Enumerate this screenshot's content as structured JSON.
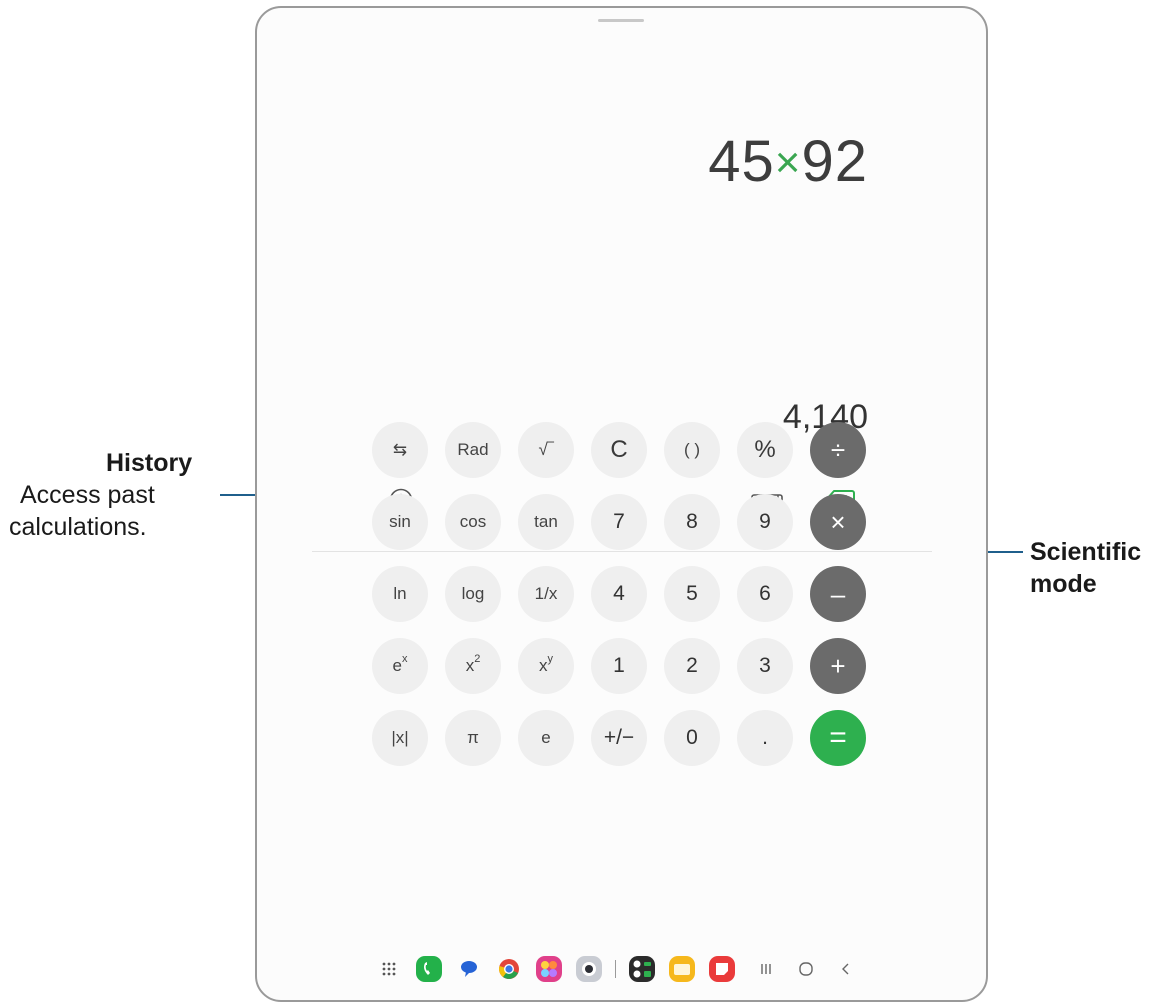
{
  "display": {
    "operand1": "45",
    "operator": "×",
    "operand2": "92",
    "result": "4,140"
  },
  "toolbar": {
    "history_icon": "clock-icon",
    "scientific_icon": "ruler-icon",
    "backspace_icon": "backspace-icon"
  },
  "keypad": {
    "rows": [
      [
        "⇆",
        "Rad",
        "√‾",
        "C",
        "( )",
        "%",
        "÷"
      ],
      [
        "sin",
        "cos",
        "tan",
        "7",
        "8",
        "9",
        "×"
      ],
      [
        "ln",
        "log",
        "1/x",
        "4",
        "5",
        "6",
        "–"
      ],
      [
        "e",
        "x",
        "x",
        "1",
        "2",
        "3",
        "+"
      ],
      [
        "|x|",
        "π",
        "e",
        "+/−",
        "0",
        ".",
        "="
      ]
    ],
    "superscripts": {
      "e_pow": "x",
      "x_sq": "2",
      "x_pow": "y"
    }
  },
  "annotations": {
    "history_title": "History",
    "history_line1": "Access past",
    "history_line2": "calculations.",
    "scientific_line1": "Scientific",
    "scientific_line2": "mode"
  },
  "colors": {
    "accent_green": "#2eb04f",
    "operator_gray": "#6b6b6b",
    "key_bg": "#efefef",
    "callout_line": "#1f5f8c"
  }
}
